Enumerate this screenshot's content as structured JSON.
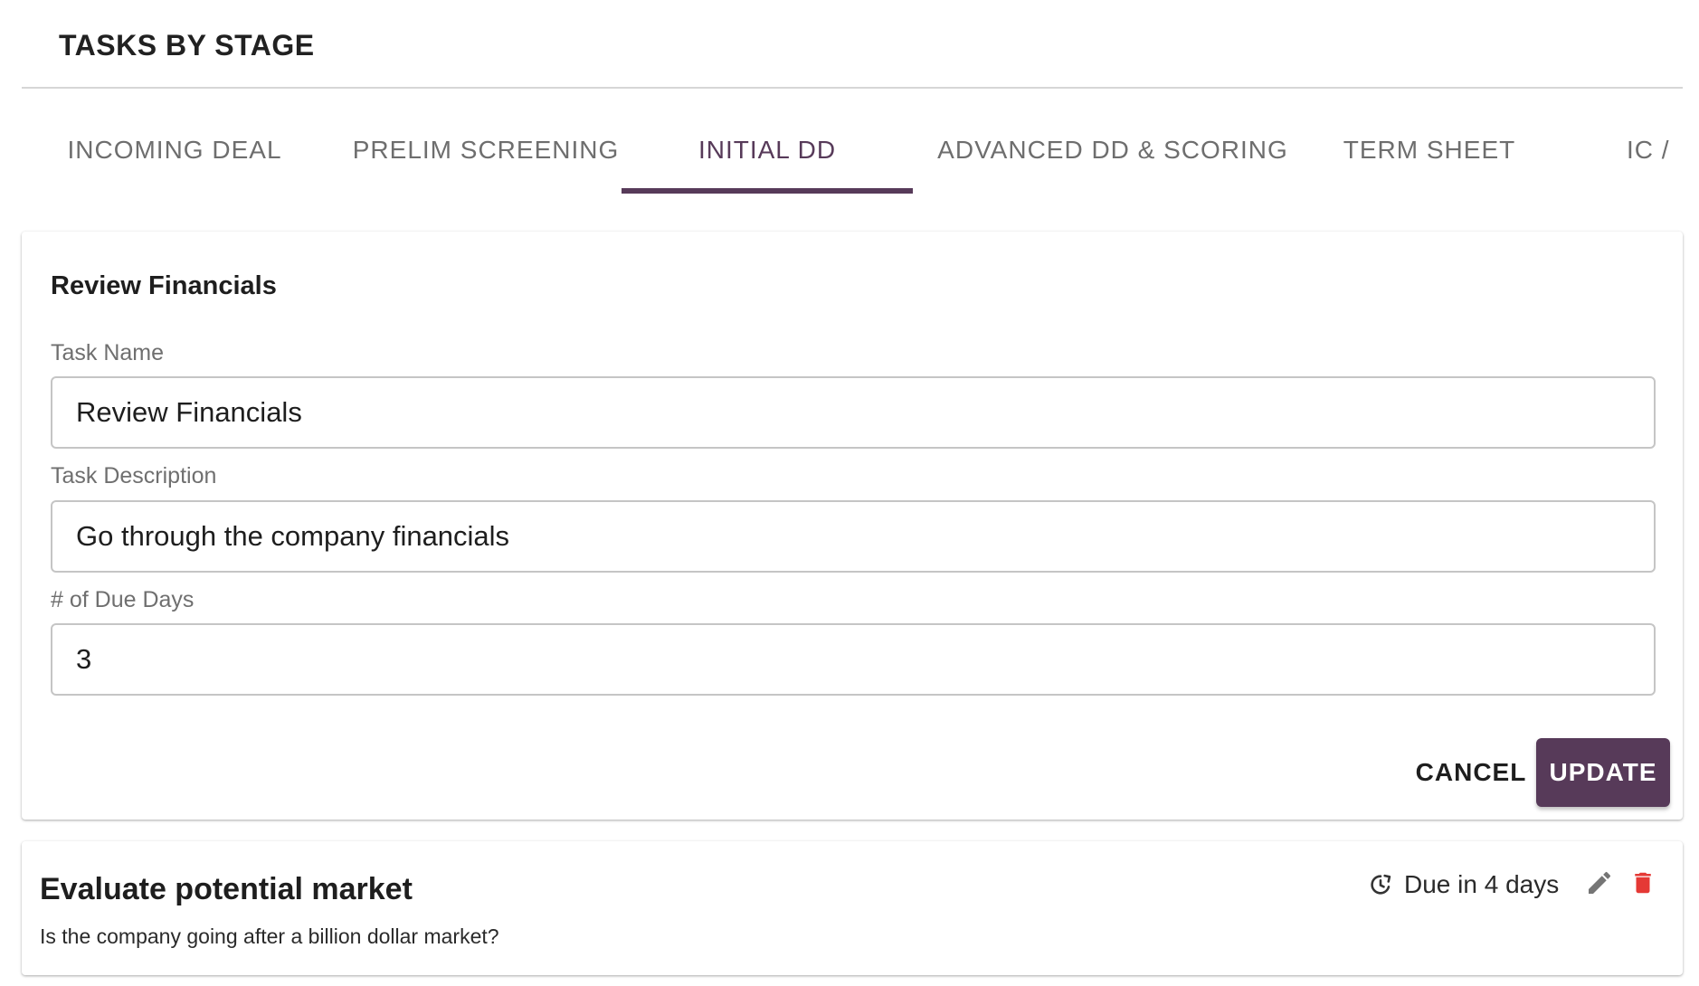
{
  "header": {
    "title": "TASKS BY STAGE"
  },
  "tabs": [
    {
      "label": "INCOMING DEAL"
    },
    {
      "label": "PRELIM SCREENING"
    },
    {
      "label": "INITIAL DD"
    },
    {
      "label": "ADVANCED DD & SCORING"
    },
    {
      "label": "TERM SHEET"
    },
    {
      "label": "IC /"
    }
  ],
  "active_tab": "INITIAL DD",
  "edit_form": {
    "title": "Review Financials",
    "task_name_label": "Task Name",
    "task_name_value": "Review Financials",
    "task_description_label": "Task Description",
    "task_description_value": "Go through the company financials",
    "due_days_label": "# of Due Days",
    "due_days_value": "3",
    "cancel_label": "CANCEL",
    "update_label": "UPDATE"
  },
  "task_list": [
    {
      "title": "Evaluate potential market",
      "description": "Is the company going after a billion dollar market?",
      "due": "Due in 4 days"
    }
  ],
  "icons": {
    "due": "schedule-refresh-icon",
    "edit": "pencil-icon",
    "delete": "trash-icon"
  },
  "colors": {
    "accent": "#573a59",
    "delete": "#e53935",
    "muted": "#6e6e6e"
  }
}
